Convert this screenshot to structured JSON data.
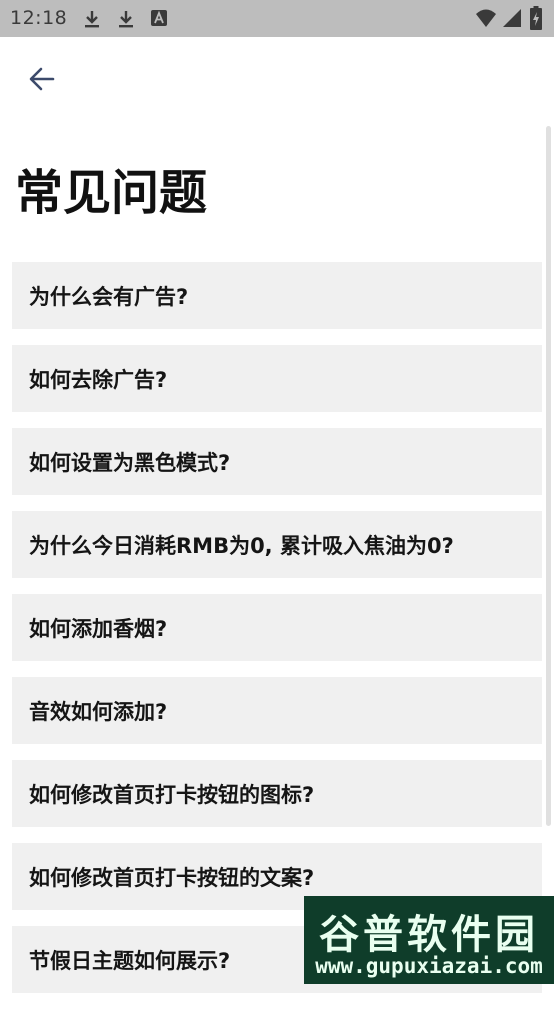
{
  "status_bar": {
    "time": "12:18",
    "icons": [
      "download-icon",
      "download-icon",
      "font-app-icon",
      "wifi-icon",
      "signal-icon",
      "battery-icon"
    ]
  },
  "header": {
    "back_icon": "arrow-left-icon"
  },
  "page": {
    "title": "常见问题"
  },
  "faq": {
    "items": [
      {
        "label": "为什么会有广告?"
      },
      {
        "label": "如何去除广告?"
      },
      {
        "label": "如何设置为黑色模式?"
      },
      {
        "label": "为什么今日消耗RMB为0, 累计吸入焦油为0?"
      },
      {
        "label": "如何添加香烟?"
      },
      {
        "label": "音效如何添加?"
      },
      {
        "label": "如何修改首页打卡按钮的图标?"
      },
      {
        "label": "如何修改首页打卡按钮的文案?"
      },
      {
        "label": "节假日主题如何展示?"
      }
    ]
  },
  "watermark": {
    "name": "谷普软件园",
    "url": "www.gupuxiazai.com"
  },
  "colors": {
    "status_bar_bg": "#bdbdbd",
    "item_bg": "#f0f0f0",
    "back_arrow": "#3c4a6b",
    "watermark_bg": "#0f3d2a"
  }
}
